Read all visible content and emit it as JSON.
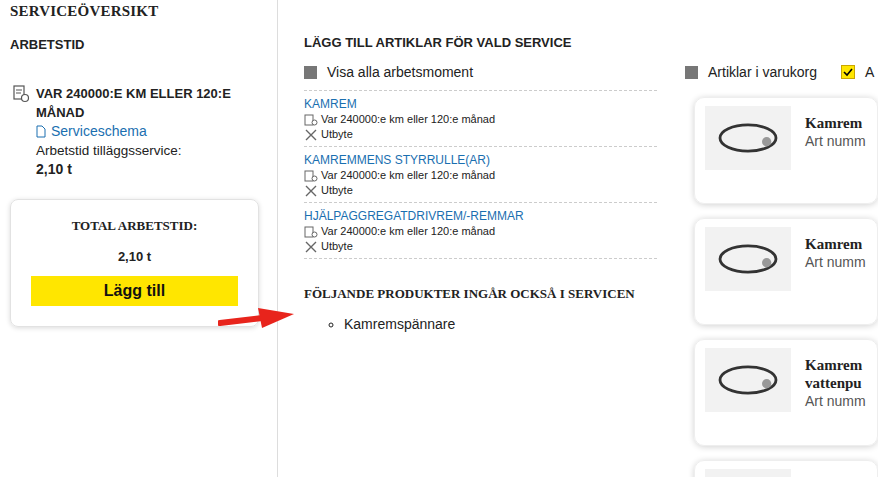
{
  "sidebar": {
    "title": "SERVICEÖVERSIKT",
    "section": "ARBETSTID",
    "interval": "VAR 240000:E KM ELLER 120:E MÅNAD",
    "schedule_link": "Serviceschema",
    "extra_label": "Arbetstid tilläggsservice:",
    "extra_value": "2,10 t",
    "total": {
      "label": "TOTAL ARBETSTID:",
      "value": "2,10 t",
      "button": "Lägg till"
    }
  },
  "articles": {
    "title": "LÄGG TILL ARTIKLAR FÖR VALD SERVICE",
    "show_all": {
      "label": "Visa alla arbetsmoment",
      "checked": false
    },
    "tasks": [
      {
        "name": "KAMREM",
        "interval": "Var 240000:e km eller 120:e månad",
        "action": "Utbyte"
      },
      {
        "name": "KAMREMMENS STYRRULLE(AR)",
        "interval": "Var 240000:e km eller 120:e månad",
        "action": "Utbyte"
      },
      {
        "name": "HJÄLPAGGREGATDRIVREM/-REMMAR",
        "interval": "Var 240000:e km eller 120:e månad",
        "action": "Utbyte"
      }
    ],
    "included_title": "FÖLJANDE PRODUKTER INGÅR OCKSÅ I SERVICEN",
    "included": [
      "Kamremspännare"
    ]
  },
  "filters": [
    {
      "label": "Artiklar i varukorg",
      "checked": false
    },
    {
      "label": "A",
      "checked": true
    }
  ],
  "products": [
    {
      "title_lines": [
        "Kamrem"
      ],
      "subtitle": "Art numm"
    },
    {
      "title_lines": [
        "Kamrem"
      ],
      "subtitle": "Art numm"
    },
    {
      "title_lines": [
        "Kamrem",
        "vattenpu"
      ],
      "subtitle": "Art numm"
    },
    {
      "title_lines": [],
      "subtitle": ""
    }
  ]
}
